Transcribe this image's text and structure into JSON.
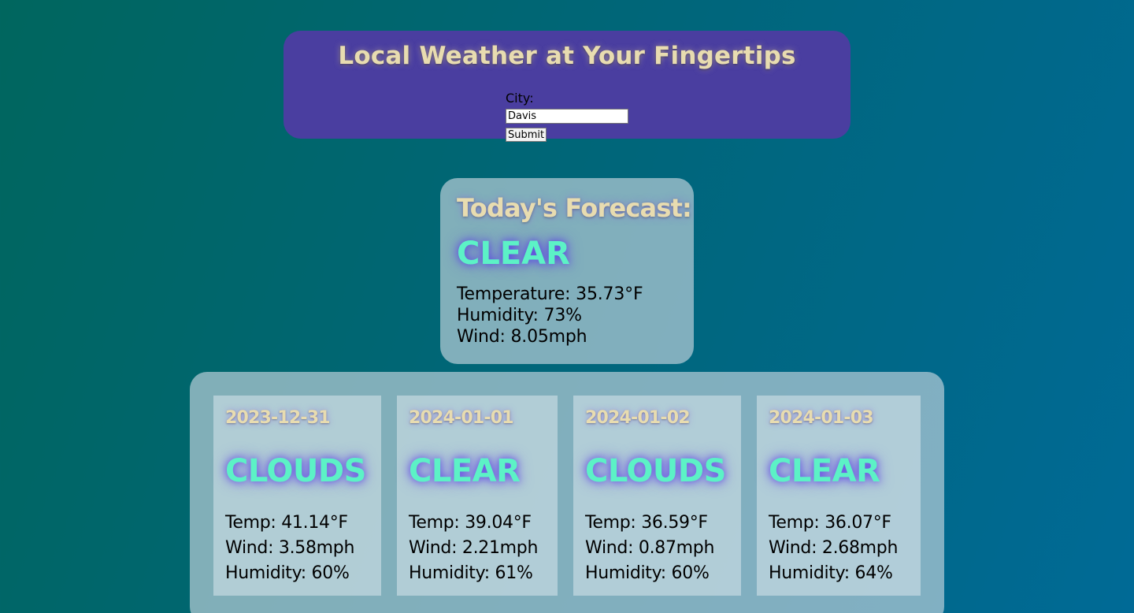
{
  "header": {
    "title": "Local Weather at Your Fingertips",
    "city_label": "City:",
    "city_value": "Davis",
    "submit_label": "Submit"
  },
  "today": {
    "heading": "Today's Forecast:",
    "condition": "CLEAR",
    "temperature": "Temperature: 35.73°F",
    "humidity": "Humidity: 73%",
    "wind": "Wind: 8.05mph"
  },
  "forecast": [
    {
      "date": "2023-12-31",
      "condition": "CLOUDS",
      "temp": "Temp: 41.14°F",
      "wind": "Wind: 3.58mph",
      "humidity": "Humidity: 60%"
    },
    {
      "date": "2024-01-01",
      "condition": "CLEAR",
      "temp": "Temp: 39.04°F",
      "wind": "Wind: 2.21mph",
      "humidity": "Humidity: 61%"
    },
    {
      "date": "2024-01-02",
      "condition": "CLOUDS",
      "temp": "Temp: 36.59°F",
      "wind": "Wind: 0.87mph",
      "humidity": "Humidity: 60%"
    },
    {
      "date": "2024-01-03",
      "condition": "CLEAR",
      "temp": "Temp: 36.07°F",
      "wind": "Wind: 2.68mph",
      "humidity": "Humidity: 64%"
    }
  ],
  "colors": {
    "header_bg": "#4a3ea0",
    "title_text": "#e8dcb0",
    "condition_text": "#5cf2c6",
    "condition_glow": "#5a3ce6"
  }
}
